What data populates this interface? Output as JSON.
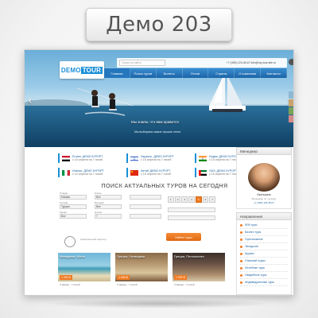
{
  "badge": {
    "title": "Демо 203"
  },
  "header": {
    "logo_demo": "DEMO",
    "logo_tour": "TOUR",
    "search_placeholder": "Поиск по сайту",
    "contacts": "+7 (495) 123-45-67  info@my-tour.site.ru",
    "nav": [
      "Главная",
      "Поиск туров",
      "Билеты",
      "Отели",
      "Страны",
      "О компании",
      "Контакты"
    ]
  },
  "hero": {
    "caption": "Мы знаем, что вам нравится",
    "subcaption": "Мы выбираем самые лучшие отели"
  },
  "offers": [
    {
      "country": "Египет",
      "title": "Египет, ДЕМО КУРОРТ",
      "sub": "с 15 апреля на 7 ночей"
    },
    {
      "country": "Израиль",
      "title": "Израиль, ДЕМО КУРОРТ",
      "sub": "с 15 апреля на 7 ночей"
    },
    {
      "country": "Индия",
      "title": "Индия, ДЕМО КУРОРТ",
      "sub": "с 15 апреля на 7 ночей"
    },
    {
      "country": "Италия",
      "title": "Италия, ДЕМО КУРОРТ",
      "sub": "с 15 апреля на 7 ночей"
    },
    {
      "country": "Китай",
      "title": "Китай, ДЕМО КУРОРТ",
      "sub": "с 15 апреля на 7 ночей"
    },
    {
      "country": "ОАЭ",
      "title": "ОАЭ, ДЕМО КУРОРТ",
      "sub": "с 15 апреля на 7 ночей"
    }
  ],
  "search": {
    "title": "ПОИСК АКТУАЛЬНЫХ ТУРОВ НА СЕГОДНЯ",
    "labels": [
      "Откуда",
      "Страна",
      "Курорт",
      "Отель",
      "Питание",
      "Ночей"
    ],
    "values": [
      "Москва",
      "Турция",
      "Все",
      "Все",
      "Все",
      "7"
    ],
    "calendar": [
      "1",
      "2",
      "3",
      "4",
      "5",
      "6",
      "7"
    ],
    "calendar_selected": 4,
    "find_button": "Найти туры",
    "partner_text": "Официальный партнер"
  },
  "tours": [
    {
      "title": "Мальдивы, Мале",
      "price": "1 000 $",
      "meta": "4 звезды · 7 ночей"
    },
    {
      "title": "Греция, Халкидики",
      "price": "1 000 $",
      "meta": "4 звезды · 7 ночей"
    },
    {
      "title": "Греция, Пелопоннес",
      "price": "1 000 $",
      "meta": "4 звезды · 7 ночей"
    }
  ],
  "sidebar": {
    "manager_title": "Менеджер",
    "manager_name": "Екатерина",
    "manager_role": "Менеджер по туризму",
    "manager_phone": "+7 (495) 123-45-67",
    "directions_title": "Направления",
    "directions": [
      "SPA туры",
      "Бизнес туры",
      "Горнолыжные",
      "Экскурсии",
      "Круизы",
      "Пляжный отдых",
      "Лечебные туры",
      "Свадебные туры",
      "Индивидуальные туры"
    ]
  },
  "colors": {
    "brand_blue": "#1a8fd8",
    "accent_orange": "#f07a22",
    "nav_blue": "#1c64a8"
  }
}
